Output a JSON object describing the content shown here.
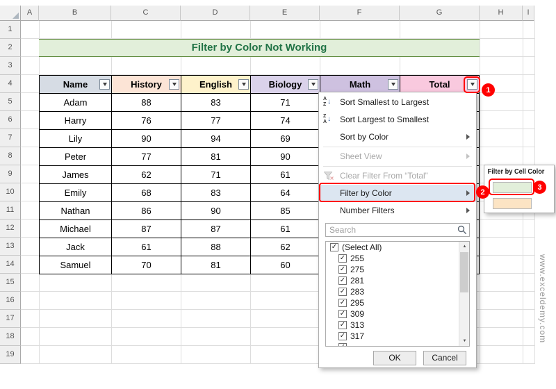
{
  "watermark": "www.exceldemy.com",
  "sheet": {
    "columns": [
      "A",
      "B",
      "C",
      "D",
      "E",
      "F",
      "G",
      "H",
      "I"
    ],
    "rows": [
      "1",
      "2",
      "3",
      "4",
      "5",
      "6",
      "7",
      "8",
      "9",
      "10",
      "11",
      "12",
      "13",
      "14",
      "15",
      "16",
      "17",
      "18",
      "19"
    ]
  },
  "banner": {
    "text": "Filter by Color Not Working"
  },
  "table": {
    "headers": [
      "Name",
      "History",
      "English",
      "Biology",
      "Math",
      "Total"
    ],
    "rows": [
      {
        "name": "Adam",
        "history": "88",
        "english": "83",
        "biology": "71"
      },
      {
        "name": "Harry",
        "history": "76",
        "english": "77",
        "biology": "74"
      },
      {
        "name": "Lily",
        "history": "90",
        "english": "94",
        "biology": "69"
      },
      {
        "name": "Peter",
        "history": "77",
        "english": "81",
        "biology": "90"
      },
      {
        "name": "James",
        "history": "62",
        "english": "71",
        "biology": "61"
      },
      {
        "name": "Emily",
        "history": "68",
        "english": "83",
        "biology": "64"
      },
      {
        "name": "Nathan",
        "history": "86",
        "english": "90",
        "biology": "85"
      },
      {
        "name": "Michael",
        "history": "87",
        "english": "87",
        "biology": "61"
      },
      {
        "name": "Jack",
        "history": "61",
        "english": "88",
        "biology": "62"
      },
      {
        "name": "Samuel",
        "history": "70",
        "english": "81",
        "biology": "60"
      }
    ]
  },
  "filter_menu": {
    "sort_smallest": "Sort Smallest to Largest",
    "sort_largest": "Sort Largest to Smallest",
    "sort_by_color": "Sort by Color",
    "sheet_view": "Sheet View",
    "clear_filter": "Clear Filter From “Total”",
    "filter_by_color": "Filter by Color",
    "number_filters": "Number Filters",
    "search_placeholder": "Search",
    "list_items": [
      "(Select All)",
      "255",
      "275",
      "281",
      "283",
      "295",
      "309",
      "313",
      "317"
    ],
    "ok_label": "OK",
    "cancel_label": "Cancel"
  },
  "color_submenu": {
    "title": "Filter by Cell Color",
    "swatches": [
      {
        "label": "light-green",
        "color": "#E2EFDA"
      },
      {
        "label": "light-orange",
        "color": "#FCE4C4"
      }
    ]
  },
  "annotations": {
    "step1": "1",
    "step2": "2",
    "step3": "3"
  },
  "colors": {
    "annotation_red": "#FF0000",
    "banner_bg": "#E2EFDA",
    "banner_text": "#217346",
    "menu_highlight": "#DCE6F1",
    "header_fills": {
      "name": "#D6DCE4",
      "history": "#FCE4D6",
      "english": "#FEF2CB",
      "biology": "#DAD2EA",
      "math": "#CEC1E0",
      "total": "#F9C9DE"
    }
  }
}
